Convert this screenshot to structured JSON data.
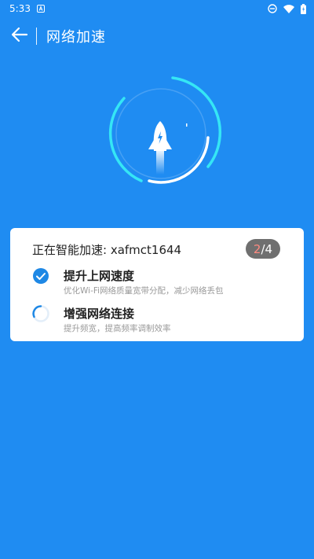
{
  "status_bar": {
    "time": "5:33",
    "icons": [
      "app-notification-icon",
      "do-not-disturb-icon",
      "wifi-icon",
      "battery-icon"
    ]
  },
  "header": {
    "title": "网络加速"
  },
  "gauge": {
    "icon": "rocket-icon",
    "accent_color": "#35e6f5"
  },
  "card": {
    "title": "正在智能加速: xafmct1644",
    "progress_current": "2",
    "progress_total": "/4",
    "tasks": [
      {
        "name": "提升上网速度",
        "desc": "优化Wi-Fi网络质量宽带分配，减少网络丢包",
        "status": "done",
        "icon": "check-circle-icon"
      },
      {
        "name": "增强网络连接",
        "desc": "提升频宽，提高频率调制效率",
        "status": "in-progress",
        "icon": "spinner-icon"
      }
    ]
  },
  "colors": {
    "background": "#1f8cf2",
    "check": "#1e88e5",
    "progress_current": "#ff8a80",
    "pill": "#6f6f6f"
  }
}
